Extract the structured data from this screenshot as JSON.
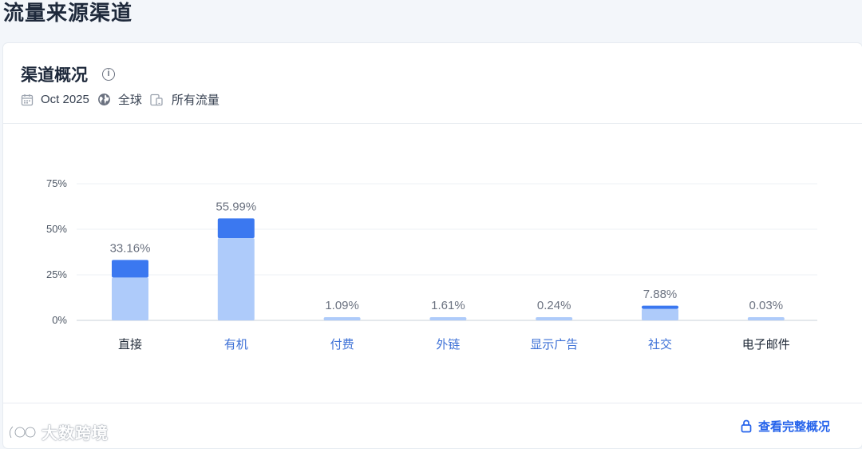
{
  "page": {
    "title": "流量来源渠道"
  },
  "card": {
    "title": "渠道概况",
    "meta": {
      "date": "Oct 2025",
      "region": "全球",
      "traffic": "所有流量"
    },
    "footer_link": "查看完整概况"
  },
  "watermark": {
    "text": "大数跨境"
  },
  "colors": {
    "light_bar": "#aecbfa",
    "dark_bar": "#3b78f0",
    "label": "#6b7280",
    "blue_label": "#3b6fd6",
    "link": "#2563eb"
  },
  "chart_data": {
    "type": "bar",
    "stacked": true,
    "categories": [
      "直接",
      "有机",
      "付费",
      "外链",
      "显示广告",
      "社交",
      "电子邮件"
    ],
    "values": [
      33.16,
      55.99,
      1.09,
      1.61,
      0.24,
      7.88,
      0.03
    ],
    "value_labels": [
      "33.16%",
      "55.99%",
      "1.09%",
      "1.61%",
      "0.24%",
      "7.88%",
      "0.03%"
    ],
    "series": [
      {
        "values": [
          23.5,
          45.2,
          1.09,
          1.61,
          0.24,
          6.3,
          0.03
        ]
      },
      {
        "values": [
          9.66,
          10.79,
          0,
          0,
          0,
          1.58,
          0
        ]
      }
    ],
    "category_colors": [
      "#1f2937",
      "#3b6fd6",
      "#3b6fd6",
      "#3b6fd6",
      "#3b6fd6",
      "#3b6fd6",
      "#1f2937"
    ],
    "yticks": [
      0,
      25,
      50,
      75
    ],
    "ytick_labels": [
      "0%",
      "25%",
      "50%",
      "75%"
    ],
    "ylim": [
      0,
      75
    ],
    "grid": true
  }
}
